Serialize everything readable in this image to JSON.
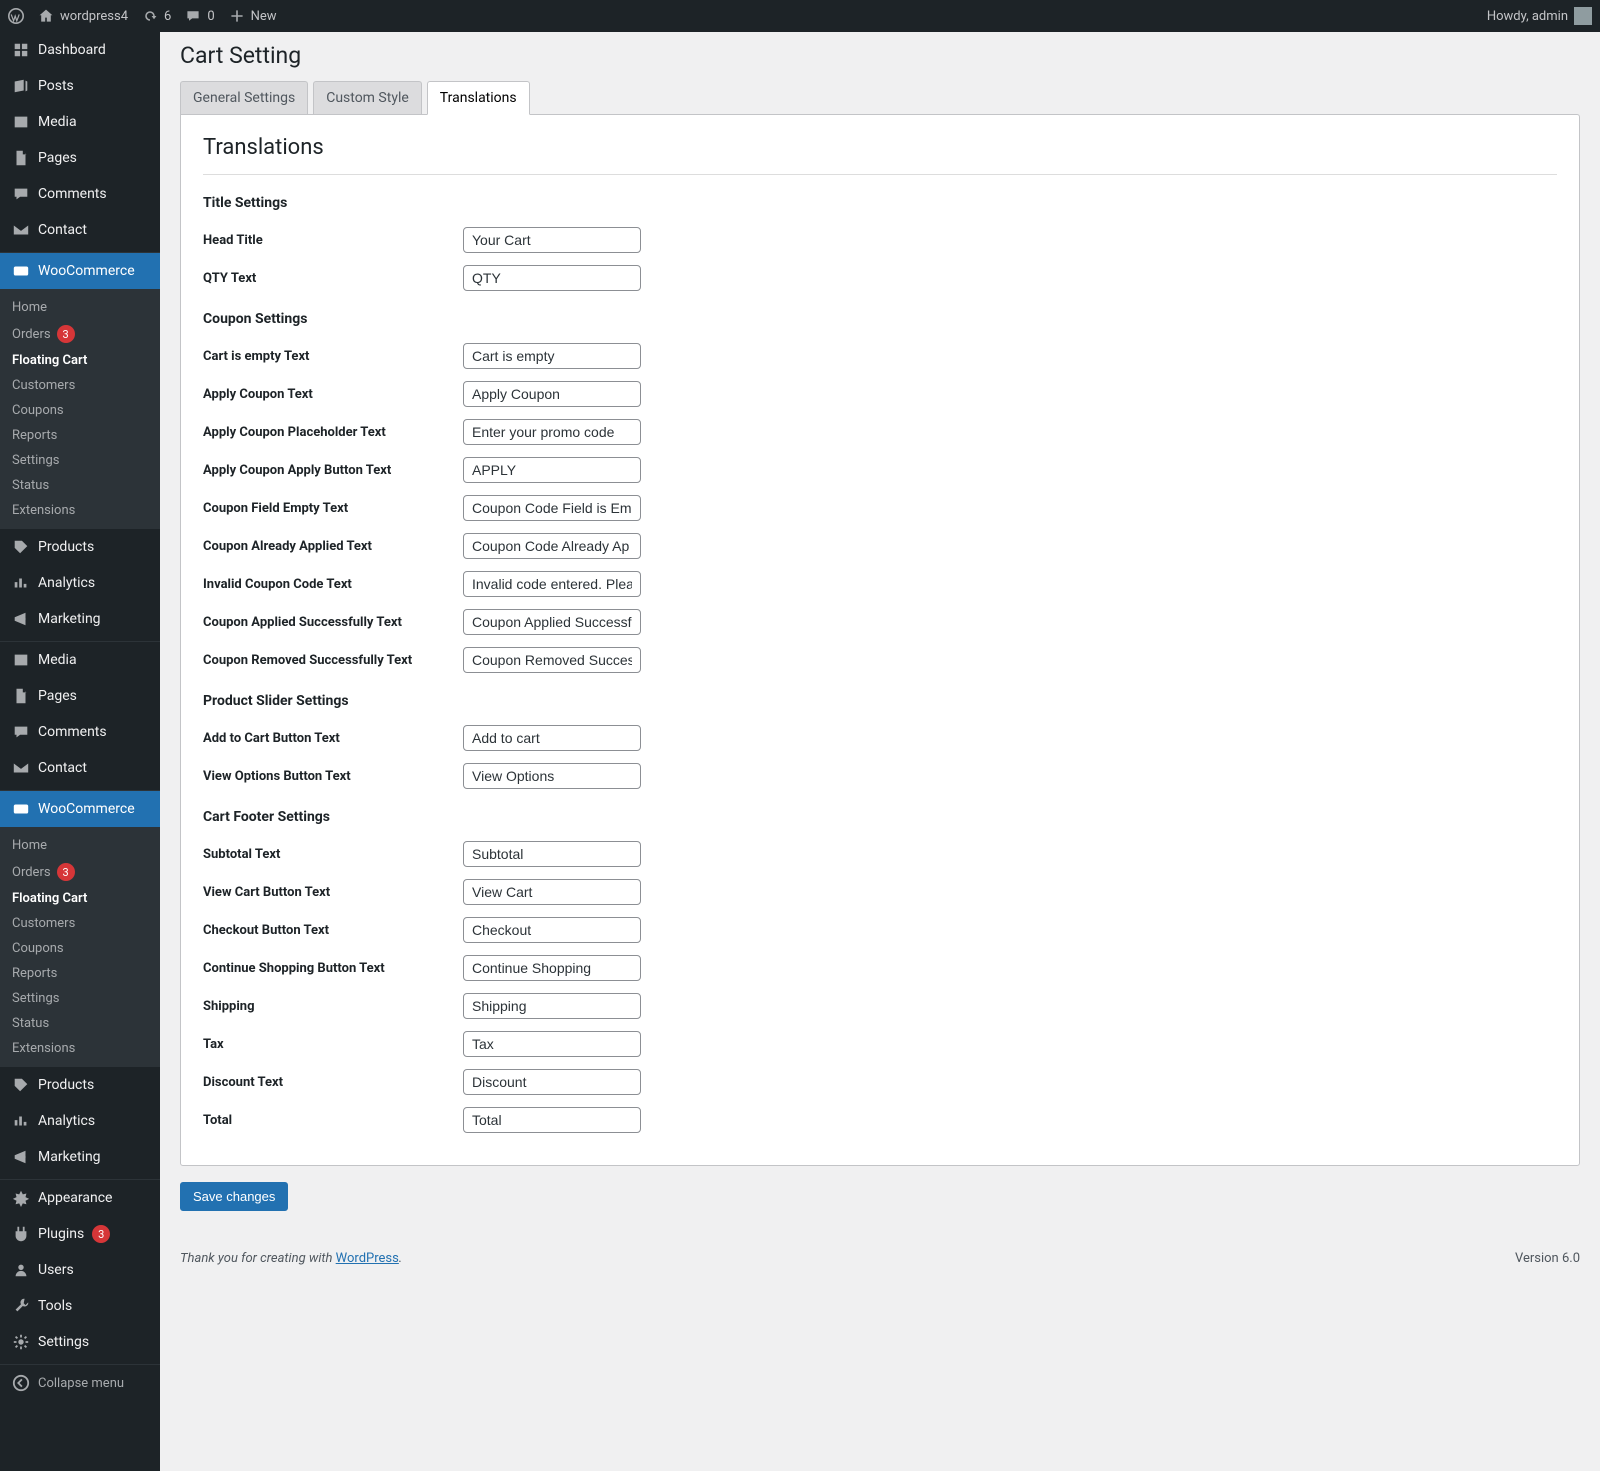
{
  "adminbar": {
    "site_name": "wordpress4",
    "refresh_count": "6",
    "comment_count": "0",
    "new_label": "New",
    "howdy": "Howdy, admin"
  },
  "sidebar": {
    "items": [
      {
        "label": "Dashboard"
      },
      {
        "label": "Posts"
      },
      {
        "label": "Media"
      },
      {
        "label": "Pages"
      },
      {
        "label": "Comments"
      },
      {
        "label": "Contact"
      }
    ],
    "wc": {
      "label": "WooCommerce"
    },
    "wc_submenu": [
      {
        "label": "Home"
      },
      {
        "label": "Orders",
        "badge": "3"
      },
      {
        "label": "Floating Cart",
        "current": true
      },
      {
        "label": "Customers"
      },
      {
        "label": "Coupons"
      },
      {
        "label": "Reports"
      },
      {
        "label": "Settings"
      },
      {
        "label": "Status"
      },
      {
        "label": "Extensions"
      }
    ],
    "items2": [
      {
        "label": "Products"
      },
      {
        "label": "Analytics"
      },
      {
        "label": "Marketing"
      }
    ],
    "items3": [
      {
        "label": "Media"
      },
      {
        "label": "Pages"
      },
      {
        "label": "Comments"
      },
      {
        "label": "Contact"
      }
    ],
    "wc_submenu2": [
      {
        "label": "Home"
      },
      {
        "label": "Orders",
        "badge": "3"
      },
      {
        "label": "Floating Cart",
        "current": true
      },
      {
        "label": "Customers"
      },
      {
        "label": "Coupons"
      },
      {
        "label": "Reports"
      },
      {
        "label": "Settings"
      },
      {
        "label": "Status"
      },
      {
        "label": "Extensions"
      }
    ],
    "items4": [
      {
        "label": "Products"
      },
      {
        "label": "Analytics"
      },
      {
        "label": "Marketing"
      }
    ],
    "items5": [
      {
        "label": "Appearance"
      },
      {
        "label": "Plugins",
        "badge": "3"
      },
      {
        "label": "Users"
      },
      {
        "label": "Tools"
      },
      {
        "label": "Settings"
      }
    ],
    "collapse": "Collapse menu"
  },
  "page": {
    "title": "Cart Setting",
    "tabs": [
      {
        "label": "General Settings"
      },
      {
        "label": "Custom Style"
      },
      {
        "label": "Translations"
      }
    ],
    "section_title": "Translations",
    "groups": [
      {
        "heading": "Title Settings",
        "fields": [
          {
            "label": "Head Title",
            "value": "Your Cart"
          },
          {
            "label": "QTY Text",
            "value": "QTY"
          }
        ]
      },
      {
        "heading": "Coupon Settings",
        "fields": [
          {
            "label": "Cart is empty Text",
            "value": "Cart is empty"
          },
          {
            "label": "Apply Coupon Text",
            "value": "Apply Coupon"
          },
          {
            "label": "Apply Coupon Placeholder Text",
            "value": "Enter your promo code"
          },
          {
            "label": "Apply Coupon Apply Button Text",
            "value": "APPLY"
          },
          {
            "label": "Coupon Field Empty Text",
            "value": "Coupon Code Field is Emp"
          },
          {
            "label": "Coupon Already Applied Text",
            "value": "Coupon Code Already Ap"
          },
          {
            "label": "Invalid Coupon Code Text",
            "value": "Invalid code entered. Plea"
          },
          {
            "label": "Coupon Applied Successfully Text",
            "value": "Coupon Applied Successfu"
          },
          {
            "label": "Coupon Removed Successfully Text",
            "value": "Coupon Removed Success"
          }
        ]
      },
      {
        "heading": "Product Slider Settings",
        "fields": [
          {
            "label": "Add to Cart Button Text",
            "value": "Add to cart"
          },
          {
            "label": "View Options Button Text",
            "value": "View Options"
          }
        ]
      },
      {
        "heading": "Cart Footer Settings",
        "fields": [
          {
            "label": "Subtotal Text",
            "value": "Subtotal"
          },
          {
            "label": "View Cart Button Text",
            "value": "View Cart"
          },
          {
            "label": "Checkout Button Text",
            "value": "Checkout"
          },
          {
            "label": "Continue Shopping Button Text",
            "value": "Continue Shopping"
          },
          {
            "label": "Shipping",
            "value": "Shipping"
          },
          {
            "label": "Tax",
            "value": "Tax"
          },
          {
            "label": "Discount Text",
            "value": "Discount"
          },
          {
            "label": "Total",
            "value": "Total"
          }
        ]
      }
    ],
    "save_button": "Save changes"
  },
  "footer": {
    "thanks": "Thank you for creating with ",
    "link_text": "WordPress",
    "period": ".",
    "version": "Version 6.0"
  }
}
